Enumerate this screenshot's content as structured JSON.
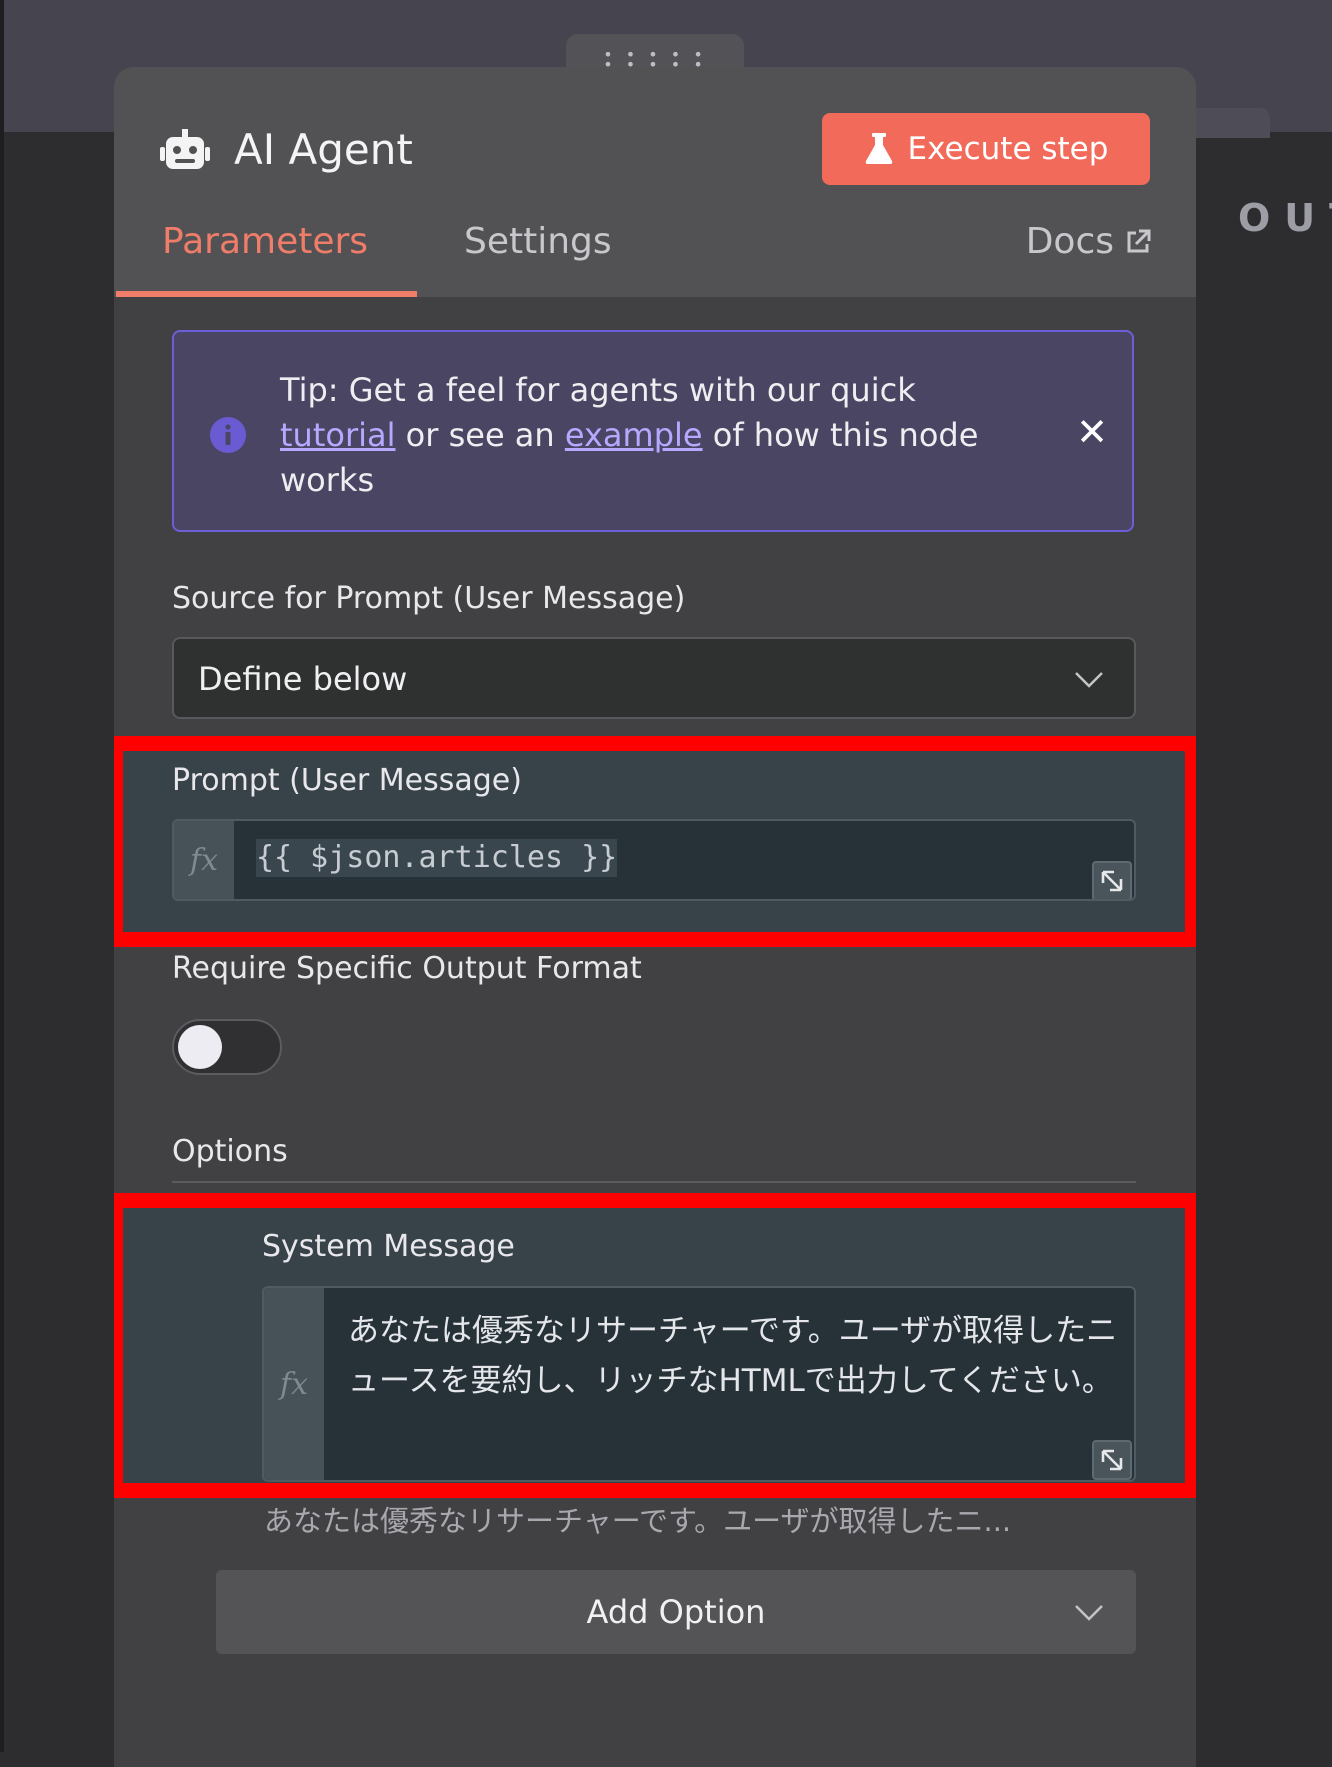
{
  "background": {
    "output_label": "OUT"
  },
  "node": {
    "title": "AI Agent",
    "execute_label": "Execute step",
    "tabs": [
      {
        "label": "Parameters",
        "active": true
      },
      {
        "label": "Settings",
        "active": false
      }
    ],
    "docs_label": "Docs"
  },
  "tip": {
    "prefix": "Tip: Get a feel for agents with our quick ",
    "link1": "tutorial",
    "middle": " or see an ",
    "link2": "example",
    "suffix": " of how this node works",
    "close_symbol": "✕"
  },
  "source_field": {
    "label": "Source for Prompt (User Message)",
    "value": "Define below"
  },
  "prompt_field": {
    "label": "Prompt (User Message)",
    "fx": "fx",
    "value": "{{ $json.articles }}"
  },
  "output_format": {
    "label": "Require Specific Output Format",
    "enabled": false
  },
  "options": {
    "heading": "Options",
    "system_message": {
      "label": "System Message",
      "fx": "fx",
      "value": "あなたは優秀なリサーチャーです。ユーザが取得したニュースを要約し、リッチなHTMLで出力してください。",
      "hint": "あなたは優秀なリサーチャーです。ユーザが取得したニ..."
    },
    "add_option_label": "Add Option"
  },
  "colors": {
    "accent": "#f26a5a",
    "highlight": "#ff0000",
    "tip_border": "#6c5ed6",
    "link": "#b4a9ff"
  },
  "icons": [
    "drag-handle-icon",
    "robot-icon",
    "flask-icon",
    "external-link-icon",
    "info-icon",
    "close-icon",
    "chevron-down-icon",
    "expand-icon"
  ]
}
